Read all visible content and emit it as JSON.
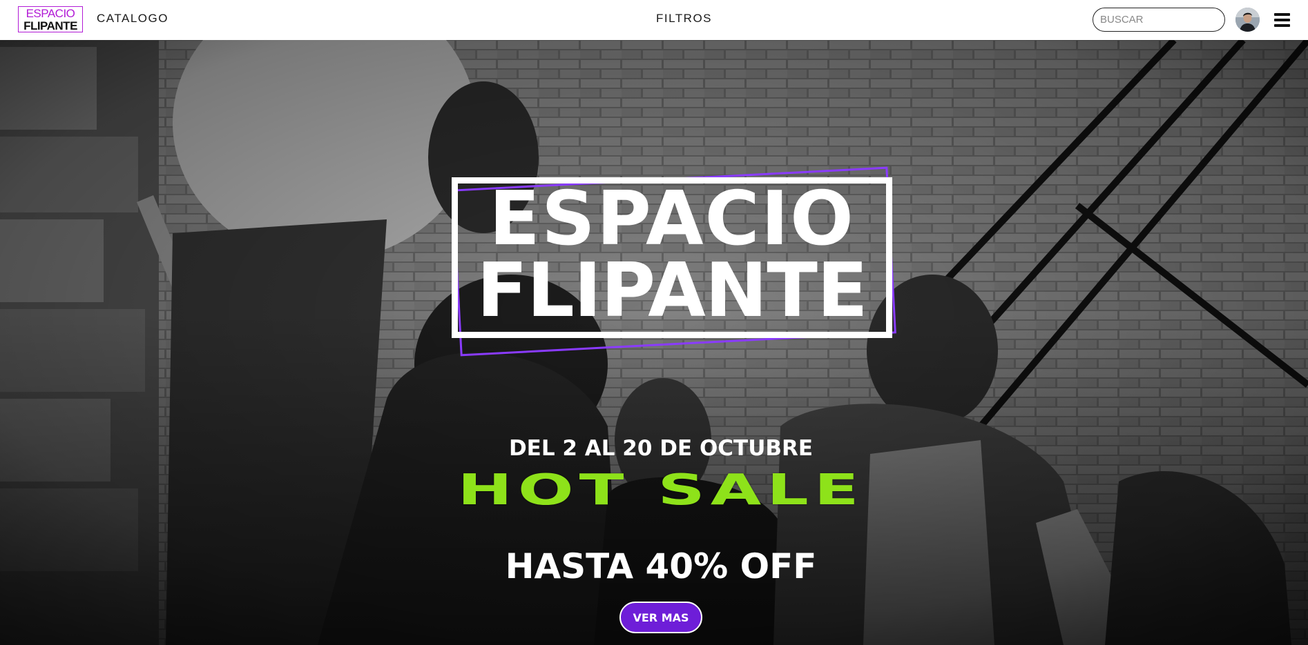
{
  "header": {
    "logo_line1": "ESPACIO",
    "logo_line2": "FLIPANTE",
    "nav_catalogo": "CATALOGO",
    "nav_filtros": "FILTROS",
    "search_placeholder": "BUSCAR",
    "avatar_icon": "user-avatar-icon",
    "menu_icon": "hamburger-menu-icon"
  },
  "hero": {
    "brand_line1": "ESPACIO",
    "brand_line2": "FLIPANTE",
    "date_text": "DEL 2 AL 20 DE OCTUBRE",
    "sale_title": "HOT SALE",
    "discount_text": "HASTA 40% OFF",
    "cta_label": "VER MAS"
  },
  "colors": {
    "brand_purple": "#b21bd6",
    "accent_purple": "#8a3bff",
    "cta_purple": "#6e1ed8",
    "sale_green": "#8ee21a",
    "header_bg": "#ffffff"
  }
}
